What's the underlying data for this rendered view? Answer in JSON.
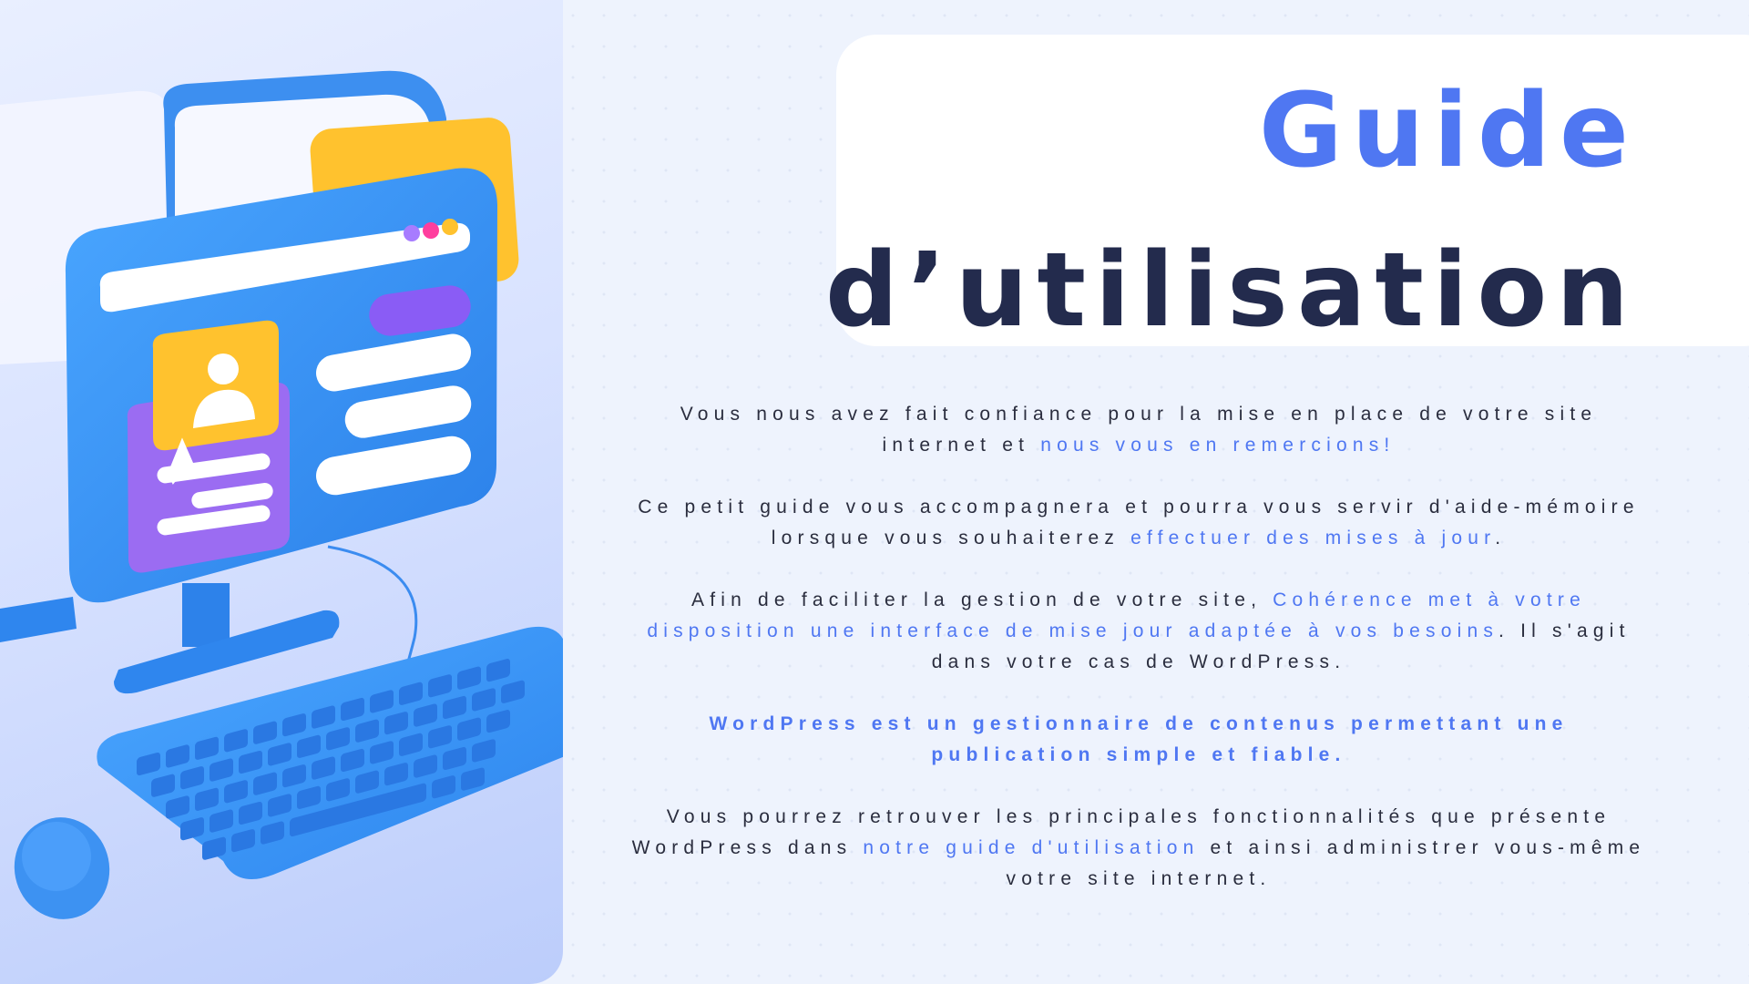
{
  "title": {
    "line1": "Guide",
    "line2": "d’utilisation"
  },
  "colors": {
    "accent": "#4f77f2",
    "title_dark": "#232b4d",
    "text": "#2a2d3e",
    "background": "#eef3fd"
  },
  "illustration": {
    "subject": "computer-monitor-keyboard-mouse-illustration"
  },
  "paragraphs": [
    {
      "a": "Vous nous avez fait confiance pour la mise en place de votre site internet et ",
      "b": "nous vous en remercions!"
    },
    {
      "a": "Ce petit guide vous accompagnera et pourra vous servir d'aide-mémoire lorsque vous souhaiterez ",
      "b": "effectuer des mises à jour",
      "c": "."
    },
    {
      "a": "Afin de faciliter la gestion de votre site, ",
      "b": "Cohérence met à votre disposition une interface de mise jour adaptée à vos besoins",
      "c": ". Il s'agit dans votre cas de WordPress."
    },
    {
      "a": "WordPress est un gestionnaire de contenus permettant une publication simple et fiable."
    },
    {
      "a": "Vous pourrez retrouver les principales fonctionnalités que présente WordPress dans ",
      "b": "notre guide d'utilisation",
      "c": " et ainsi administrer vous-même votre site internet."
    }
  ]
}
